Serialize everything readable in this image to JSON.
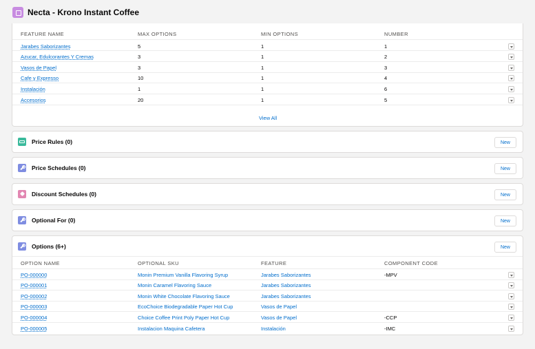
{
  "header": {
    "title": "Necta - Krono Instant Coffee",
    "icon": "product-icon"
  },
  "features": {
    "columns": [
      "FEATURE NAME",
      "MAX OPTIONS",
      "MIN OPTIONS",
      "NUMBER"
    ],
    "rows": [
      {
        "name": "Jarabes Saborizantes",
        "max": "5",
        "min": "1",
        "number": "1"
      },
      {
        "name": "Azucar, Edulcorantes Y Cremas",
        "max": "3",
        "min": "1",
        "number": "2"
      },
      {
        "name": "Vasos de Papel",
        "max": "3",
        "min": "1",
        "number": "3"
      },
      {
        "name": "Cafe y Expresso",
        "max": "10",
        "min": "1",
        "number": "4"
      },
      {
        "name": "Instalación",
        "max": "1",
        "min": "1",
        "number": "6"
      },
      {
        "name": "Accesorios",
        "max": "20",
        "min": "1",
        "number": "5"
      }
    ],
    "view_all": "View All"
  },
  "sections": [
    {
      "title": "Price Rules (0)",
      "button": "New",
      "icon": "price-rules-icon",
      "color": "#3bba9c"
    },
    {
      "title": "Price Schedules (0)",
      "button": "New",
      "icon": "wrench-icon",
      "color": "#7f8de1"
    },
    {
      "title": "Discount Schedules (0)",
      "button": "New",
      "icon": "tag-icon",
      "color": "#e287b2"
    },
    {
      "title": "Optional For (0)",
      "button": "New",
      "icon": "wrench-icon",
      "color": "#7f8de1"
    }
  ],
  "options": {
    "title": "Options (6+)",
    "button": "New",
    "columns": [
      "OPTION NAME",
      "OPTIONAL SKU",
      "FEATURE",
      "COMPONENT CODE"
    ],
    "rows": [
      {
        "name": "PO-000000",
        "sku": "Monin Premium Vanilla Flavoring Syrup",
        "feature": "Jarabes Saborizantes",
        "code": "-MPV"
      },
      {
        "name": "PO-000001",
        "sku": "Monin Caramel Flavoring Sauce",
        "feature": "Jarabes Saborizantes",
        "code": ""
      },
      {
        "name": "PO-000002",
        "sku": "Monin White Chocolate Flavoring Sauce",
        "feature": "Jarabes Saborizantes",
        "code": ""
      },
      {
        "name": "PO-000003",
        "sku": "EcoChoice Biodegradable Paper Hot Cup",
        "feature": "Vasos de Papel",
        "code": ""
      },
      {
        "name": "PO-000004",
        "sku": "Choice Coffee Print Poly Paper Hot Cup",
        "feature": "Vasos de Papel",
        "code": "-CCP"
      },
      {
        "name": "PO-000005",
        "sku": "Instalacion Maquina Cafetera",
        "feature": "Instalación",
        "code": "-IMC"
      }
    ]
  }
}
